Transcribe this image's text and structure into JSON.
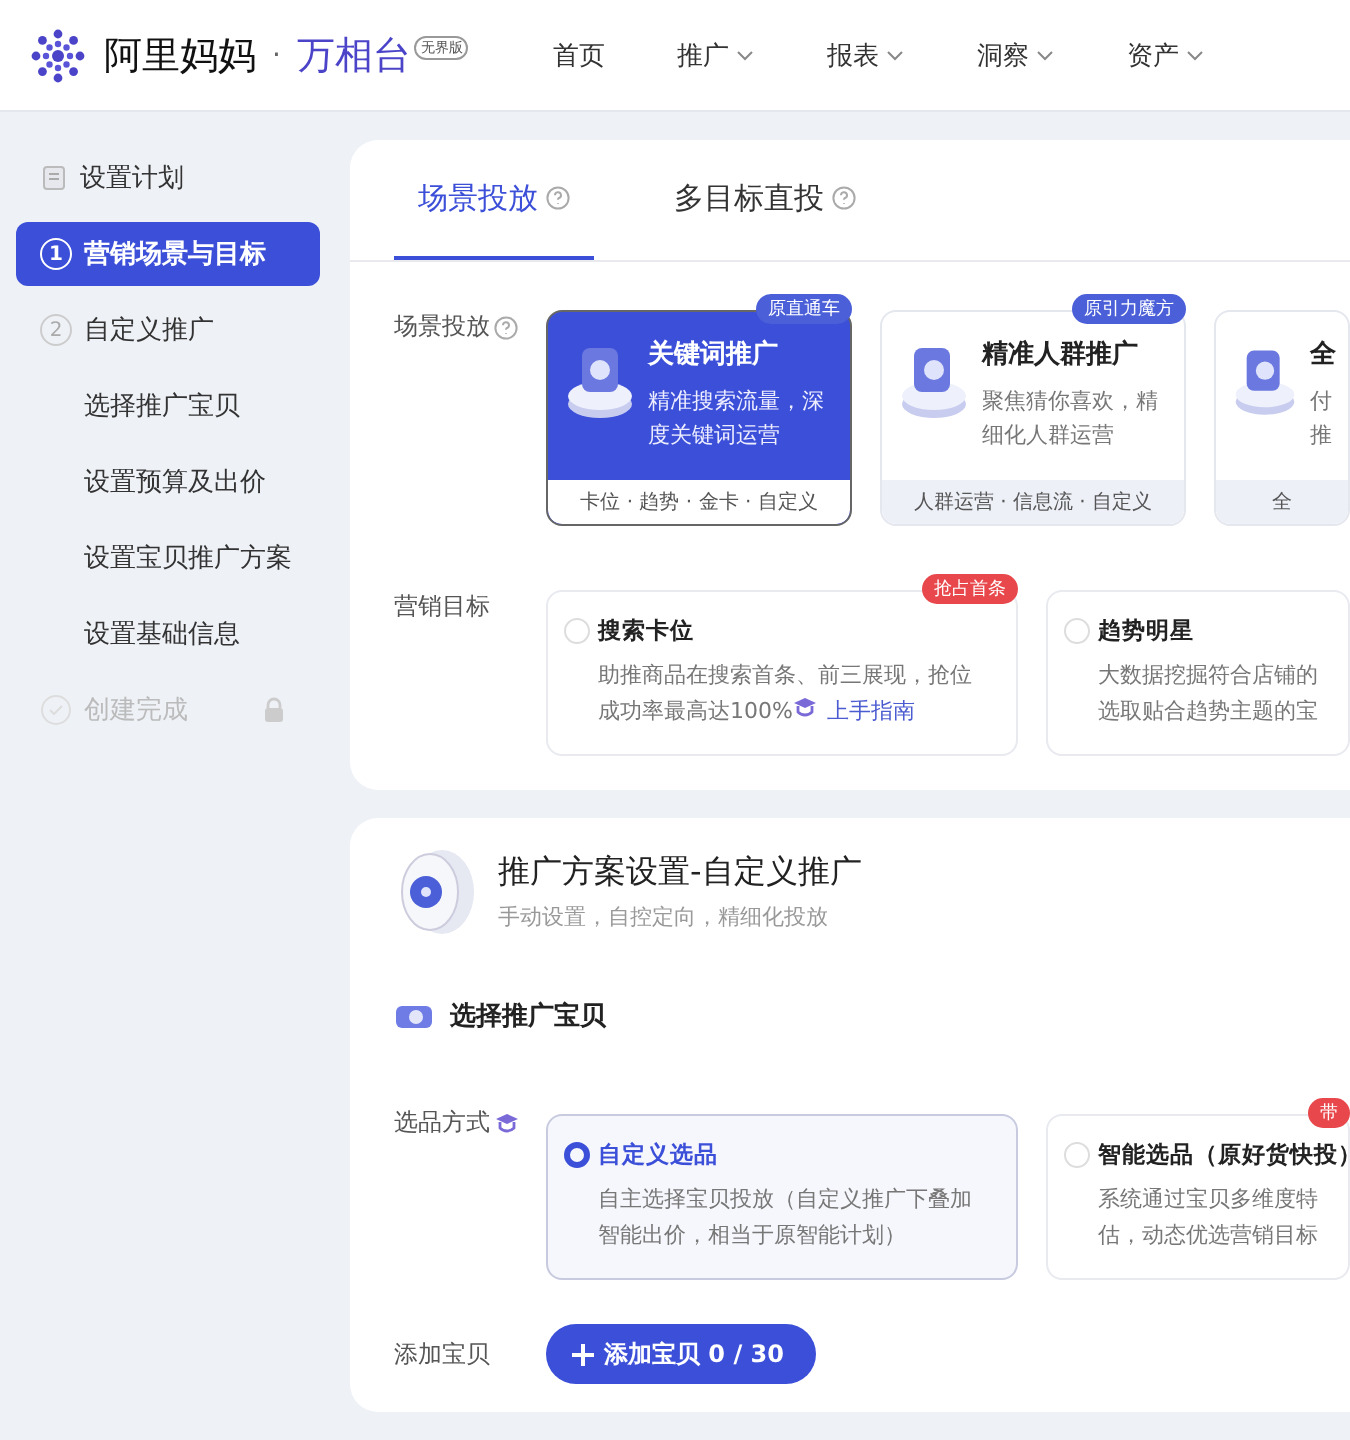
{
  "header": {
    "brand": "阿里妈妈",
    "separator": "·",
    "product": "万相台",
    "edition": "无界版",
    "nav": [
      {
        "label": "首页",
        "dropdown": false
      },
      {
        "label": "推广",
        "dropdown": true
      },
      {
        "label": "报表",
        "dropdown": true
      },
      {
        "label": "洞察",
        "dropdown": true
      },
      {
        "label": "资产",
        "dropdown": true
      }
    ]
  },
  "sidebar": {
    "items": [
      {
        "kind": "plan",
        "label": "设置计划",
        "selected": false,
        "disabled": false
      },
      {
        "kind": "step",
        "number": "1",
        "label": "营销场景与目标",
        "selected": true,
        "disabled": false
      },
      {
        "kind": "step",
        "number": "2",
        "label": "自定义推广",
        "selected": false,
        "disabled": false
      },
      {
        "kind": "sub",
        "label": "选择推广宝贝",
        "selected": false,
        "disabled": false
      },
      {
        "kind": "sub",
        "label": "设置预算及出价",
        "selected": false,
        "disabled": false
      },
      {
        "kind": "sub",
        "label": "设置宝贝推广方案",
        "selected": false,
        "disabled": false
      },
      {
        "kind": "sub",
        "label": "设置基础信息",
        "selected": false,
        "disabled": false
      },
      {
        "kind": "done",
        "label": "创建完成",
        "selected": false,
        "disabled": true
      }
    ]
  },
  "tabs": [
    {
      "label": "场景投放",
      "selected": true
    },
    {
      "label": "多目标直投",
      "selected": false
    }
  ],
  "scene": {
    "label": "场景投放",
    "cards": [
      {
        "title": "关键词推广",
        "desc_lines": [
          "精准搜索流量，深",
          "度关键词运营"
        ],
        "footer": "卡位 · 趋势 · 金卡 · 自定义",
        "badge": "原直通车",
        "selected": true
      },
      {
        "title": "精准人群推广",
        "desc_lines": [
          "聚焦猜你喜欢，精",
          "细化人群运营"
        ],
        "footer": "人群运营 · 信息流 · 自定义",
        "badge": "原引力魔方",
        "selected": false
      },
      {
        "title": "全",
        "desc_lines": [
          "付",
          "推"
        ],
        "footer": "全",
        "selected": false
      }
    ]
  },
  "goal": {
    "label": "营销目标",
    "options": [
      {
        "title": "搜索卡位",
        "desc_lines": [
          "助推商品在搜索首条、前三展现，抢位",
          "成功率最高达100%"
        ],
        "link": "上手指南",
        "badge": "抢占首条",
        "selected": false
      },
      {
        "title": "趋势明星",
        "desc_lines": [
          "大数据挖掘符合店铺的",
          "选取贴合趋势主题的宝"
        ],
        "selected": false
      }
    ]
  },
  "plan": {
    "title": "推广方案设置-自定义推广",
    "subtitle": "手动设置，自控定向，精细化投放",
    "section": "选择推广宝贝",
    "select_label": "选品方式",
    "options": [
      {
        "title": "自定义选品",
        "desc_lines": [
          "自主选择宝贝投放（自定义推广下叠加",
          "智能出价，相当于原智能计划）"
        ],
        "selected": true
      },
      {
        "title": "智能选品（原好货快投）",
        "desc_lines": [
          "系统通过宝贝多维度特",
          "估，动态优选营销目标"
        ],
        "badge": "带",
        "selected": false
      }
    ],
    "add_label": "添加宝贝",
    "add_button": "添加宝贝 0 / 30"
  }
}
